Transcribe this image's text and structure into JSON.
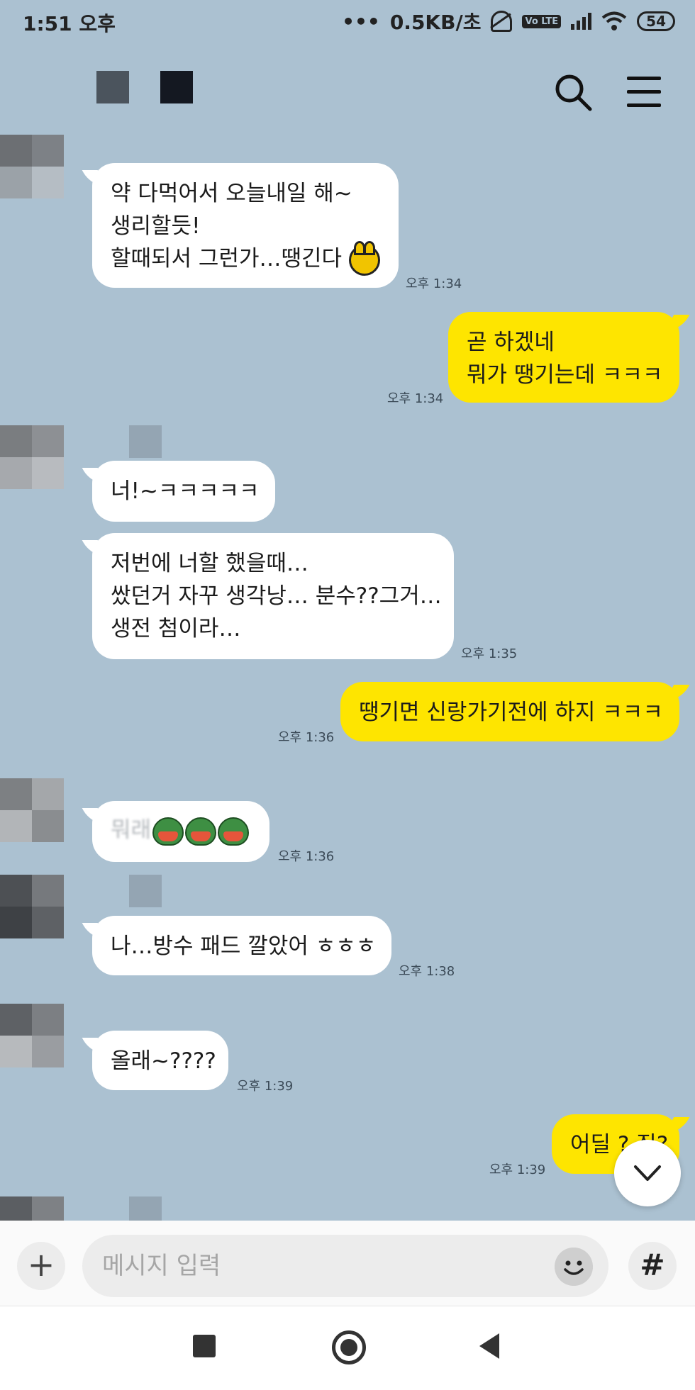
{
  "status_bar": {
    "time": "1:51 오후",
    "net_speed": "0.5KB/초",
    "volte_label": "Vo LTE",
    "battery": "54"
  },
  "header": {
    "search_icon": "search-icon",
    "menu_icon": "menu-icon"
  },
  "messages": [
    {
      "side": "in",
      "lines": [
        "약 다먹어서 오늘내일 해~",
        "생리할듯!",
        "할때되서 그런가…땡긴다"
      ],
      "time": "오후 1:34"
    },
    {
      "side": "out",
      "lines": [
        "곧 하겠네",
        "뭐가 땡기는데 ㅋㅋㅋ"
      ],
      "time": "오후 1:34"
    },
    {
      "side": "in",
      "lines": [
        "너!~ㅋㅋㅋㅋㅋ"
      ],
      "time": ""
    },
    {
      "side": "in",
      "lines": [
        "저번에 너할 했을때…",
        "쌌던거 자꾸 생각낭… 분수??그거…",
        "생전 첨이라…"
      ],
      "time": "오후 1:35"
    },
    {
      "side": "out",
      "lines": [
        "땡기면 신랑가기전에 하지 ㅋㅋㅋ"
      ],
      "time": "오후 1:36"
    },
    {
      "side": "in",
      "lines": [
        "뭐래"
      ],
      "time": "오후 1:36"
    },
    {
      "side": "in",
      "lines": [
        "나…방수 패드 깔았어 ㅎㅎㅎ"
      ],
      "time": "오후 1:38"
    },
    {
      "side": "in",
      "lines": [
        "올래~????"
      ],
      "time": "오후 1:39"
    },
    {
      "side": "out",
      "lines": [
        "어딜 ? 집?"
      ],
      "time": "오후 1:39"
    }
  ],
  "input": {
    "placeholder": "메시지 입력",
    "plus_label": "+",
    "hash_label": "#"
  },
  "colors": {
    "background": "#abc1d1",
    "incoming": "#ffffff",
    "outgoing": "#fee500"
  }
}
